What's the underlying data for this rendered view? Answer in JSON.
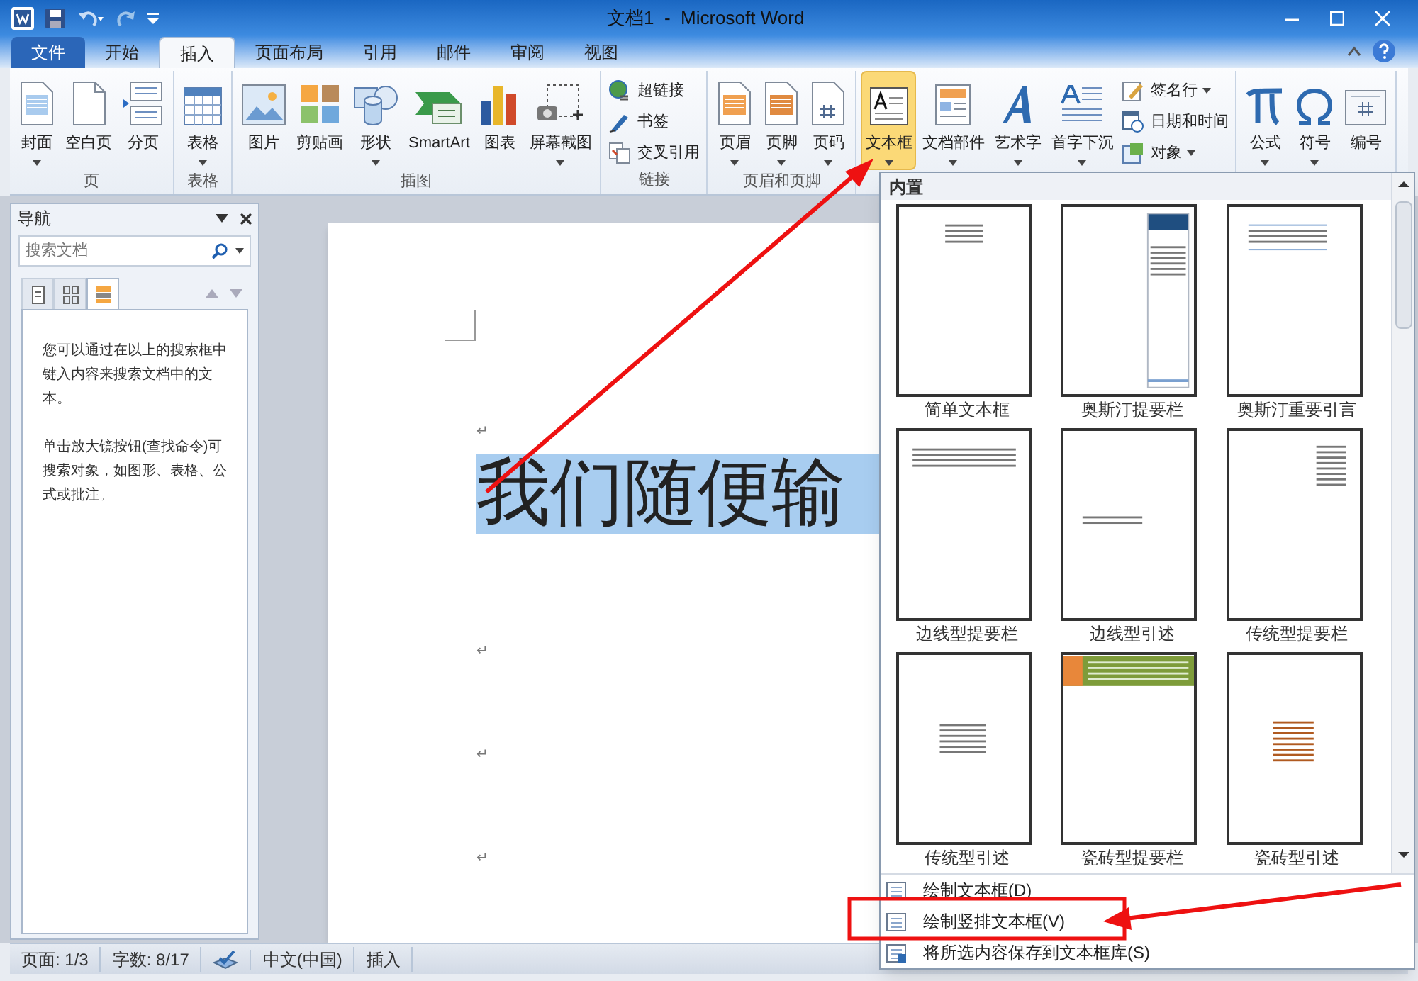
{
  "window": {
    "title": "文档1  -  Microsoft Word"
  },
  "ribbon_tabs": [
    {
      "label": "文件",
      "kind": "file",
      "selected": false
    },
    {
      "label": "开始",
      "kind": "tab",
      "selected": false
    },
    {
      "label": "插入",
      "kind": "tab",
      "selected": true
    },
    {
      "label": "页面布局",
      "kind": "tab",
      "selected": false
    },
    {
      "label": "引用",
      "kind": "tab",
      "selected": false
    },
    {
      "label": "邮件",
      "kind": "tab",
      "selected": false
    },
    {
      "label": "审阅",
      "kind": "tab",
      "selected": false
    },
    {
      "label": "视图",
      "kind": "tab",
      "selected": false
    }
  ],
  "ribbon_groups": [
    {
      "label": "页",
      "buttons": [
        {
          "label": "封面",
          "kind": "large",
          "dropdown": true,
          "selected": false
        },
        {
          "label": "空白页",
          "kind": "large",
          "dropdown": false,
          "selected": false
        },
        {
          "label": "分页",
          "kind": "large",
          "dropdown": false,
          "selected": false
        }
      ]
    },
    {
      "label": "表格",
      "buttons": [
        {
          "label": "表格",
          "kind": "large",
          "dropdown": true,
          "selected": false
        }
      ]
    },
    {
      "label": "插图",
      "buttons": [
        {
          "label": "图片",
          "kind": "large",
          "dropdown": false,
          "selected": false
        },
        {
          "label": "剪贴画",
          "kind": "large",
          "dropdown": false,
          "selected": false
        },
        {
          "label": "形状",
          "kind": "large",
          "dropdown": true,
          "selected": false
        },
        {
          "label": "SmartArt",
          "kind": "large",
          "dropdown": false,
          "selected": false
        },
        {
          "label": "图表",
          "kind": "large",
          "dropdown": false,
          "selected": false
        },
        {
          "label": "屏幕截图",
          "kind": "large",
          "dropdown": true,
          "selected": false
        }
      ]
    },
    {
      "label": "链接",
      "buttons": [
        {
          "label": "超链接",
          "kind": "small",
          "dropdown": false,
          "selected": false
        },
        {
          "label": "书签",
          "kind": "small",
          "dropdown": false,
          "selected": false
        },
        {
          "label": "交叉引用",
          "kind": "small",
          "dropdown": false,
          "selected": false
        }
      ]
    },
    {
      "label": "页眉和页脚",
      "buttons": [
        {
          "label": "页眉",
          "kind": "large",
          "dropdown": true,
          "selected": false
        },
        {
          "label": "页脚",
          "kind": "large",
          "dropdown": true,
          "selected": false
        },
        {
          "label": "页码",
          "kind": "large",
          "dropdown": true,
          "selected": false
        }
      ]
    },
    {
      "buttons": [
        {
          "label": "文本框",
          "kind": "large",
          "dropdown": true,
          "selected": true
        },
        {
          "label": "文档部件",
          "kind": "large",
          "dropdown": true,
          "selected": false
        },
        {
          "label": "艺术字",
          "kind": "large",
          "dropdown": true,
          "selected": false
        },
        {
          "label": "首字下沉",
          "kind": "large",
          "dropdown": true,
          "selected": false
        },
        {
          "label": "签名行",
          "kind": "small",
          "dropdown": true,
          "selected": false
        },
        {
          "label": "日期和时间",
          "kind": "small",
          "dropdown": false,
          "selected": false
        },
        {
          "label": "对象",
          "kind": "small",
          "dropdown": true,
          "selected": false
        }
      ]
    },
    {
      "buttons": [
        {
          "label": "公式",
          "kind": "large",
          "dropdown": true,
          "selected": false
        },
        {
          "label": "符号",
          "kind": "large",
          "dropdown": true,
          "selected": false
        },
        {
          "label": "编号",
          "kind": "large",
          "dropdown": false,
          "selected": false
        }
      ]
    }
  ],
  "navigation": {
    "title": "导航",
    "search": {
      "placeholder": "搜索文档"
    },
    "tabs": [
      {
        "selected": false
      },
      {
        "selected": false
      },
      {
        "selected": true
      }
    ],
    "paragraphs": [
      "您可以通过在以上的搜索框中键入内容来搜索文档中的文本。",
      "单击放大镜按钮(查找命令)可搜索对象，如图形、表格、公式或批注。"
    ]
  },
  "document": {
    "lines": [
      {
        "kind": "mark",
        "text": "↵"
      },
      {
        "kind": "selected",
        "text": "我们随便输"
      },
      {
        "kind": "mark",
        "text": "↵"
      },
      {
        "kind": "mark",
        "text": "↵"
      },
      {
        "kind": "mark",
        "text": "↵"
      }
    ]
  },
  "gallery": {
    "title": "内置",
    "items": [
      {
        "label": "简单文本框"
      },
      {
        "label": "奥斯汀提要栏"
      },
      {
        "label": "奥斯汀重要引言"
      },
      {
        "label": "边线型提要栏"
      },
      {
        "label": "边线型引述"
      },
      {
        "label": "传统型提要栏"
      },
      {
        "label": "传统型引述"
      },
      {
        "label": "瓷砖型提要栏"
      },
      {
        "label": "瓷砖型引述"
      }
    ],
    "menu_items": [
      {
        "label": "绘制文本框(D)"
      },
      {
        "label": "绘制竖排文本框(V)"
      },
      {
        "label": "将所选内容保存到文本框库(S)"
      }
    ]
  },
  "status_bar": {
    "items": [
      {
        "kind": "text",
        "text": "页面: 1/3"
      },
      {
        "kind": "text",
        "text": "字数: 8/17"
      },
      {
        "kind": "proofing"
      },
      {
        "kind": "text",
        "text": "中文(中国)"
      },
      {
        "kind": "text",
        "text": "插入"
      }
    ]
  }
}
